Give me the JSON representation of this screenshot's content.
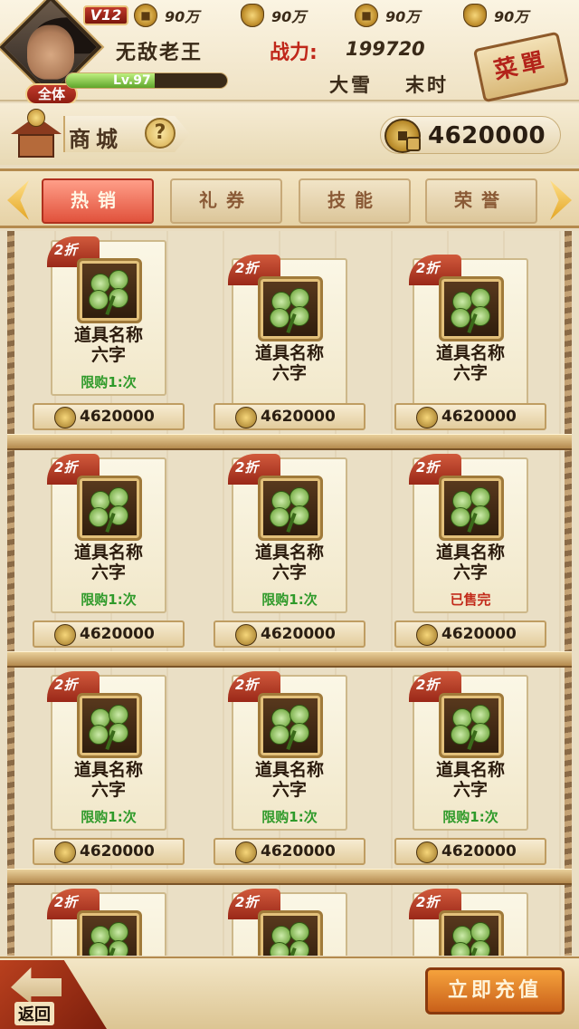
{
  "player": {
    "vip": "V12",
    "name": "无敌老王",
    "power_label": "战力",
    "power_value": "199720",
    "level": "Lv.97",
    "level_progress": 0.55,
    "badge": "全体",
    "weather": "大雪",
    "time": "末时"
  },
  "resources": [
    {
      "icon": "copper-coin-icon",
      "value": "90万"
    },
    {
      "icon": "gold-ingot-icon",
      "value": "90万"
    },
    {
      "icon": "locked-coin-icon",
      "value": "90万"
    },
    {
      "icon": "locked-ingot-icon",
      "value": "90万"
    }
  ],
  "menu_label": "菜單",
  "shop": {
    "title": "商城",
    "help": "?",
    "balance": "4620000"
  },
  "tabs": [
    {
      "label": "热销",
      "active": true
    },
    {
      "label": "礼券",
      "active": false
    },
    {
      "label": "技能",
      "active": false
    },
    {
      "label": "荣誉",
      "active": false
    }
  ],
  "items": [
    {
      "discount": "2折",
      "name": "道具名称六字",
      "limit": "限购1:次",
      "price": "4620000",
      "sold_out": false
    },
    {
      "discount": "2折",
      "name": "道具名称六字",
      "limit": "",
      "price": "4620000",
      "sold_out": false
    },
    {
      "discount": "2折",
      "name": "道具名称六字",
      "limit": "",
      "price": "4620000",
      "sold_out": false
    },
    {
      "discount": "2折",
      "name": "道具名称六字",
      "limit": "限购1:次",
      "price": "4620000",
      "sold_out": false
    },
    {
      "discount": "2折",
      "name": "道具名称六字",
      "limit": "限购1:次",
      "price": "4620000",
      "sold_out": false
    },
    {
      "discount": "2折",
      "name": "道具名称六字",
      "limit": "已售完",
      "price": "4620000",
      "sold_out": true
    },
    {
      "discount": "2折",
      "name": "道具名称六字",
      "limit": "限购1:次",
      "price": "4620000",
      "sold_out": false
    },
    {
      "discount": "2折",
      "name": "道具名称六字",
      "limit": "限购1:次",
      "price": "4620000",
      "sold_out": false
    },
    {
      "discount": "2折",
      "name": "道具名称六字",
      "limit": "限购1:次",
      "price": "4620000",
      "sold_out": false
    },
    {
      "discount": "2折",
      "name": "",
      "limit": "",
      "price": "",
      "sold_out": false
    },
    {
      "discount": "2折",
      "name": "",
      "limit": "",
      "price": "",
      "sold_out": false
    },
    {
      "discount": "2折",
      "name": "",
      "limit": "",
      "price": "",
      "sold_out": false
    }
  ],
  "bottom": {
    "back_label": "返回",
    "recharge_label": "立即充值"
  }
}
